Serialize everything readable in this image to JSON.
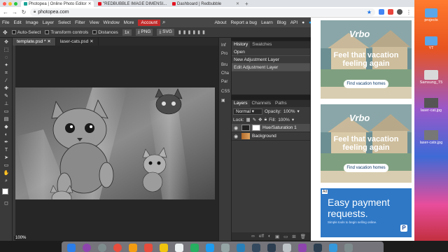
{
  "browser": {
    "tabs": [
      {
        "label": "Photopea | Online Photo Editor",
        "active": true
      },
      {
        "label": "\"REDBUBBLE IMAGE DIMENSI...",
        "active": false
      },
      {
        "label": "Dashboard | Redbubble",
        "active": false
      }
    ],
    "new_tab": "+",
    "url": "photopea.com",
    "nav": {
      "back": "←",
      "forward": "→",
      "reload": "↻"
    }
  },
  "menubar": {
    "left": [
      "File",
      "Edit",
      "Image",
      "Layer",
      "Select",
      "Filter",
      "View",
      "Window",
      "More"
    ],
    "account": "Account",
    "right": [
      "About",
      "Report a bug",
      "Learn",
      "Blog",
      "API"
    ]
  },
  "options": {
    "auto_select": "Auto-Select",
    "transform_controls": "Transform controls",
    "distances": "Distances",
    "zoom_select": "1x",
    "png": "PNG",
    "svg": "SVG"
  },
  "doc_tabs": [
    {
      "label": "template.psd *",
      "active": true
    },
    {
      "label": "laser-cats.psd",
      "active": false
    }
  ],
  "mini_panel": [
    "Inf",
    "Pro",
    "Bru",
    "Cha",
    "Par",
    "CSS"
  ],
  "history": {
    "tabs": [
      "History",
      "Swatches"
    ],
    "items": [
      "Open",
      "New Adjustment Layer",
      "Edit Adjustment Layer"
    ]
  },
  "layers": {
    "tabs": [
      "Layers",
      "Channels",
      "Paths"
    ],
    "blend_mode": "Normal",
    "opacity_label": "Opacity:",
    "opacity_value": "100%",
    "lock_label": "Lock:",
    "fill_label": "Fill:",
    "fill_value": "100%",
    "items": [
      {
        "name": "Hue/Saturation 1",
        "selected": true
      },
      {
        "name": "Background",
        "selected": false
      }
    ]
  },
  "canvas": {
    "zoom": "100%"
  },
  "ads": {
    "vrbo_logo": "Vrbo",
    "vrbo_headline": "Feel that vacation feeling again",
    "vrbo_cta": "Find vacation homes",
    "blue_badge": "Ad",
    "blue_headline": "Easy payment requests.",
    "blue_sub": "Simple tools to begin selling online."
  },
  "desktop": {
    "items": [
      "projects",
      "YT",
      "Samsung_T5",
      "laser-cat.jpg",
      "laser-cats.jpg"
    ]
  },
  "colors": {
    "account": "#c12929",
    "menubar": "#474747",
    "panel": "#3a3a3a",
    "canvas_bg": "#262626",
    "ad_blue": "#2e78c6"
  }
}
